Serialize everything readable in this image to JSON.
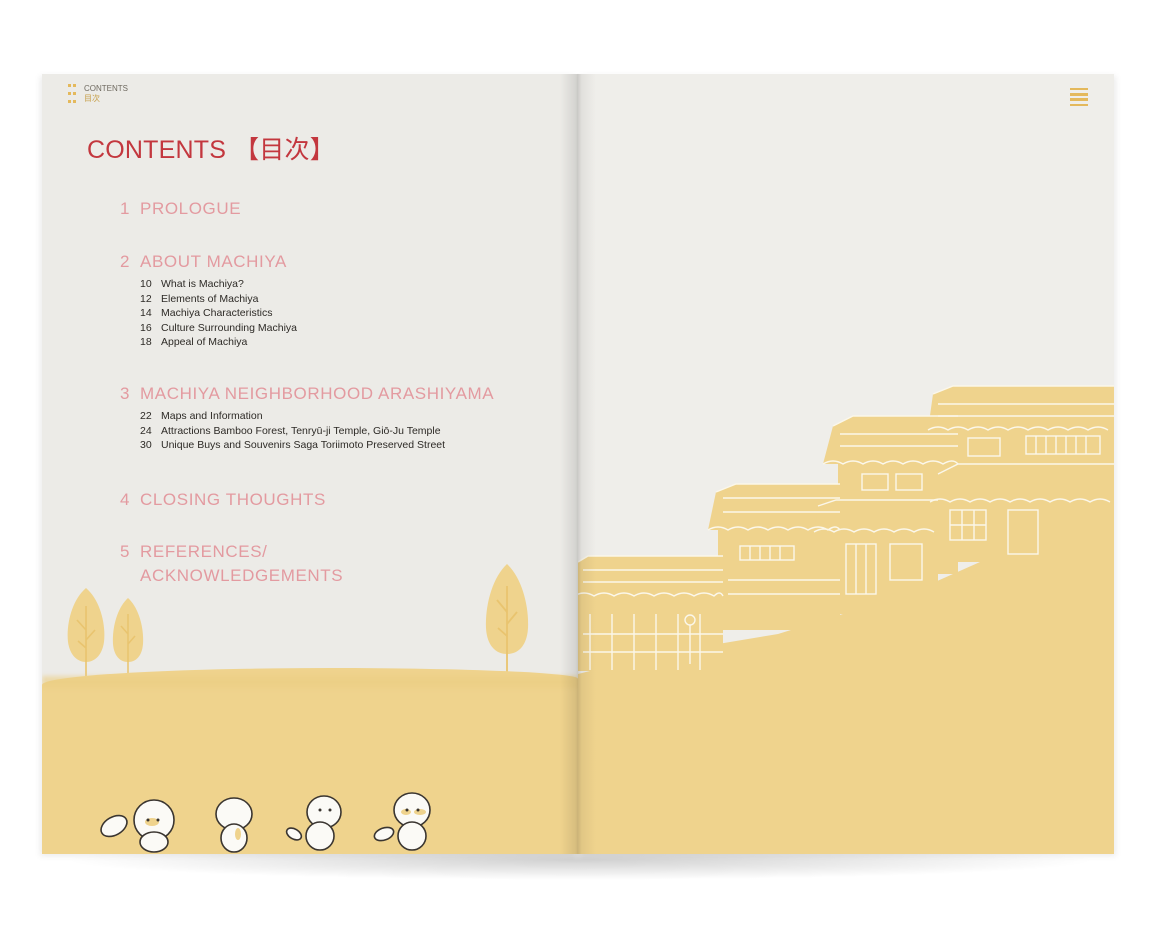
{
  "left_page": {
    "running_head": {
      "label_en": "CONTENTS",
      "label_jp": "目次"
    },
    "title": {
      "en": "CONTENTS",
      "jp": "【目次】"
    },
    "sections": [
      {
        "num": "1",
        "title": "PROLOGUE",
        "items": []
      },
      {
        "num": "2",
        "title": "ABOUT MACHIYA",
        "items": [
          {
            "page": "10",
            "text": "What is Machiya?"
          },
          {
            "page": "12",
            "text": "Elements of Machiya"
          },
          {
            "page": "14",
            "text": "Machiya Characteristics"
          },
          {
            "page": "16",
            "text": "Culture Surrounding Machiya"
          },
          {
            "page": "18",
            "text": "Appeal of Machiya"
          }
        ]
      },
      {
        "num": "3",
        "title": "MACHIYA NEIGHBORHOOD ARASHIYAMA",
        "items": [
          {
            "page": "22",
            "text": "Maps and Information"
          },
          {
            "page": "24",
            "text": "Attractions Bamboo Forest, Tenryū-ji Temple, Giō-Ju Temple"
          },
          {
            "page": "30",
            "text": "Unique Buys and Souvenirs Saga Toriimoto Preserved Street"
          }
        ]
      },
      {
        "num": "4",
        "title": "CLOSING THOUGHTS",
        "items": []
      },
      {
        "num": "5",
        "title": "REFERENCES/",
        "title_line2": "ACKNOWLEDGEMENTS",
        "items": []
      }
    ]
  },
  "right_page": {
    "icon": "menu-icon"
  },
  "colors": {
    "title_red": "#c3373e",
    "section_pink": "#e39aa0",
    "mustard": "#efd38d",
    "paper": "#ecebe7"
  }
}
